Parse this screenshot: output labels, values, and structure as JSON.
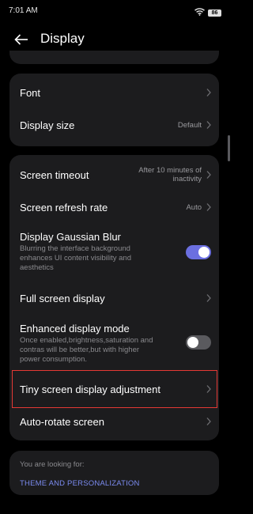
{
  "status_bar": {
    "time": "7:01 AM",
    "battery_level": "86",
    "wifi_icon": "wifi-icon"
  },
  "header": {
    "back_icon": "arrow-left-icon",
    "title": "Display"
  },
  "group1": {
    "items": [
      {
        "label": "Font",
        "value": ""
      },
      {
        "label": "Display size",
        "value": "Default"
      }
    ]
  },
  "group2": {
    "items": [
      {
        "label": "Screen timeout",
        "value": "After 10 minutes of inactivity"
      },
      {
        "label": "Screen refresh rate",
        "value": "Auto"
      },
      {
        "label": "Display Gaussian Blur",
        "description": "Blurring the interface background enhances UI content visibility and aesthetics",
        "toggle_on": true
      },
      {
        "label": "Full screen display",
        "value": ""
      },
      {
        "label": "Enhanced display mode",
        "description": "Once enabled,brightness,saturation and contras will be better,but with higher power consumption.",
        "toggle_on": false
      },
      {
        "label": "Tiny screen display adjustment",
        "value": "",
        "highlighted": true
      },
      {
        "label": "Auto-rotate screen",
        "value": ""
      }
    ]
  },
  "suggestion": {
    "label": "You are looking for:",
    "link": "THEME AND PERSONALIZATION"
  },
  "colors": {
    "background": "#000000",
    "card": "#1c1c1e",
    "accent": "#6b6fe0",
    "link": "#7b8bf0",
    "highlight_border": "#e53935",
    "toggle_off": "#5a5a5e"
  }
}
